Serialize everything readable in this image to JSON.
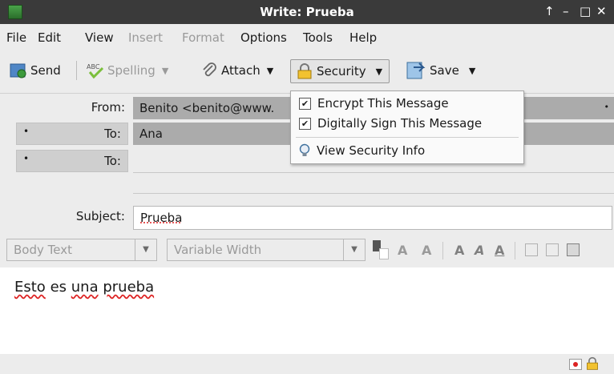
{
  "window": {
    "title": "Write: Prueba",
    "controls": [
      "↑",
      "–",
      "□",
      "✕"
    ]
  },
  "menu": [
    "File",
    "Edit",
    "View",
    "Insert",
    "Format",
    "Options",
    "Tools",
    "Help"
  ],
  "toolbar": {
    "send": "Send",
    "spelling": "Spelling",
    "attach": "Attach",
    "security": "Security",
    "save": "Save"
  },
  "security_menu": {
    "encrypt": "Encrypt This Message",
    "sign": "Digitally Sign This Message",
    "view_info": "View Security Info",
    "encrypt_checked": true,
    "sign_checked": true
  },
  "header": {
    "from_label": "From:",
    "from_value": "Benito <benito@www.",
    "to_label": "To:",
    "to_value": "Ana",
    "to2_label": "To:",
    "to2_value": "",
    "subject_label": "Subject:",
    "subject_value": "Prueba"
  },
  "format": {
    "paragraph": "Body Text",
    "font": "Variable Width"
  },
  "body": {
    "words": [
      "Esto",
      "es",
      "una",
      "prueba"
    ]
  },
  "colors": {
    "titlebar": "#3a3a3a",
    "chrome": "#ececec",
    "field_fill": "#ababab"
  }
}
